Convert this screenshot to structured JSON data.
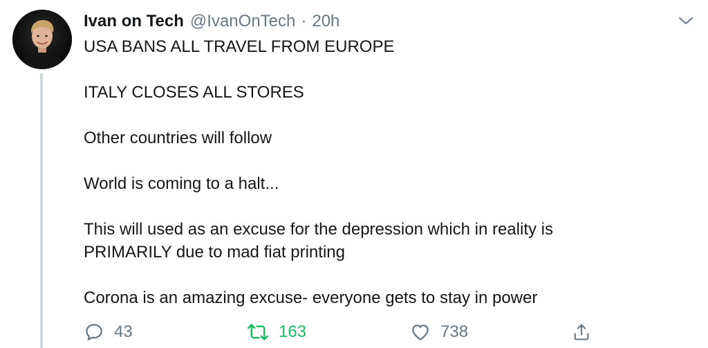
{
  "tweet": {
    "display_name": "Ivan on Tech",
    "handle": "@IvanOnTech",
    "separator": "·",
    "time": "20h",
    "paragraphs": [
      [
        "USA BANS ALL TRAVEL FROM EUROPE"
      ],
      [
        "ITALY CLOSES ALL STORES"
      ],
      [
        "Other countries will follow"
      ],
      [
        "World is coming to a halt..."
      ],
      [
        "This will used as an excuse for the depression which in reality is",
        "PRIMARILY due to mad fiat printing"
      ],
      [
        "Corona is an amazing excuse- everyone gets to stay in power"
      ]
    ],
    "actions": {
      "reply_count": "43",
      "retweet_count": "163",
      "like_count": "738"
    }
  },
  "icons": {
    "caret": "chevron-down-icon",
    "reply": "reply-icon",
    "retweet": "retweet-icon",
    "like": "heart-icon",
    "share": "share-icon"
  },
  "colors": {
    "text": "#14171a",
    "secondary": "#657786",
    "retweet_active": "#17bf63",
    "thread_line": "#cfd9de",
    "background": "#ffffff"
  }
}
